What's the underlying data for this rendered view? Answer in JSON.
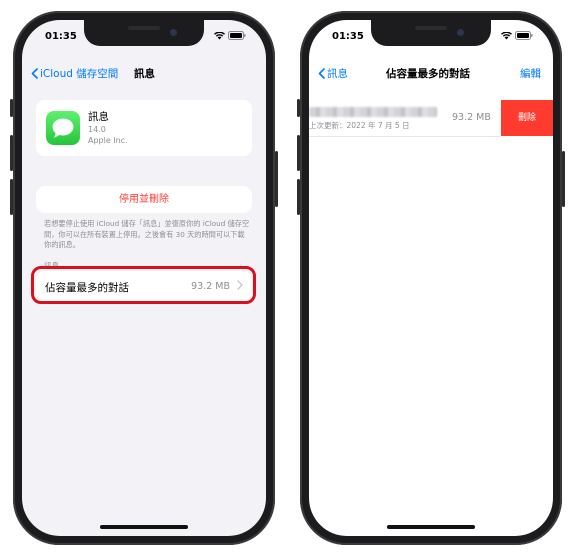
{
  "left_screen": {
    "status_time": "01:35",
    "nav_back_label": "iCloud 儲存空間",
    "nav_title": "訊息",
    "app": {
      "name": "訊息",
      "version": "14.0",
      "vendor": "Apple Inc."
    },
    "disable_delete_label": "停用並刪除",
    "footnote": "若想要停止使用 iCloud 儲存「訊息」並復原你的 iCloud 儲存空間，你可以在所有裝置上停用。之後會有 30 天的時間可以下載你的訊息。",
    "section_header": "訊息",
    "conversation_row": {
      "label": "佔容量最多的對話",
      "size": "93.2 MB"
    }
  },
  "right_screen": {
    "status_time": "01:35",
    "nav_back_label": "訊息",
    "nav_title": "佔容量最多的對話",
    "nav_edit_label": "編輯",
    "row": {
      "last_updated": "上次更新：2022 年 7 月 5 日",
      "size": "93.2 MB",
      "delete_label": "刪除"
    }
  },
  "colors": {
    "accent": "#007aff",
    "destructive": "#ff3b30",
    "highlight": "#d9101e",
    "messages_green": "#34c759"
  }
}
